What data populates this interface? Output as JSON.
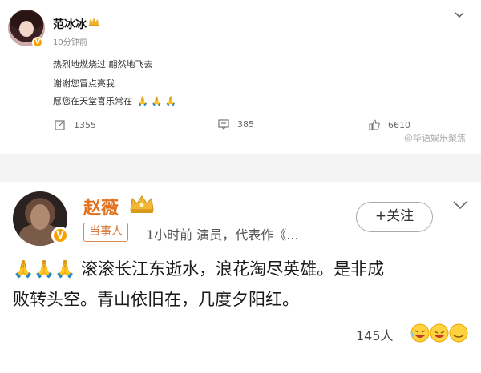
{
  "post1": {
    "username": "范冰冰",
    "timestamp": "10分钟前",
    "lines": [
      "热烈地燃烧过  翩然地飞去",
      "谢谢您冒点亮我",
      "愿您在天堂喜乐常在"
    ],
    "hands": "🙏🙏🙏",
    "repost_count": "1355",
    "comment_count": "385",
    "like_count": "6610",
    "watermark": "@华语娱乐聚焦"
  },
  "post2": {
    "username": "赵薇",
    "follow_label": "+关注",
    "tag": "当事人",
    "meta": "1小时前  演员，代表作《...",
    "hands": "🙏🙏🙏",
    "line1": "滚滚长江东逝水，浪花淘尽英雄。是非成",
    "line2": "败转头空。青山依旧在，几度夕阳红。",
    "likes": "145人"
  },
  "colors": {
    "vip_orange": "#e2731c",
    "badge_gold": "#f5a200",
    "divider_gray": "#f4f4f4"
  },
  "icons": [
    "crown-icon",
    "verified-icon",
    "more-chevron-icon",
    "repost-icon",
    "comment-icon",
    "like-icon",
    "emoji-reaction-icon"
  ]
}
